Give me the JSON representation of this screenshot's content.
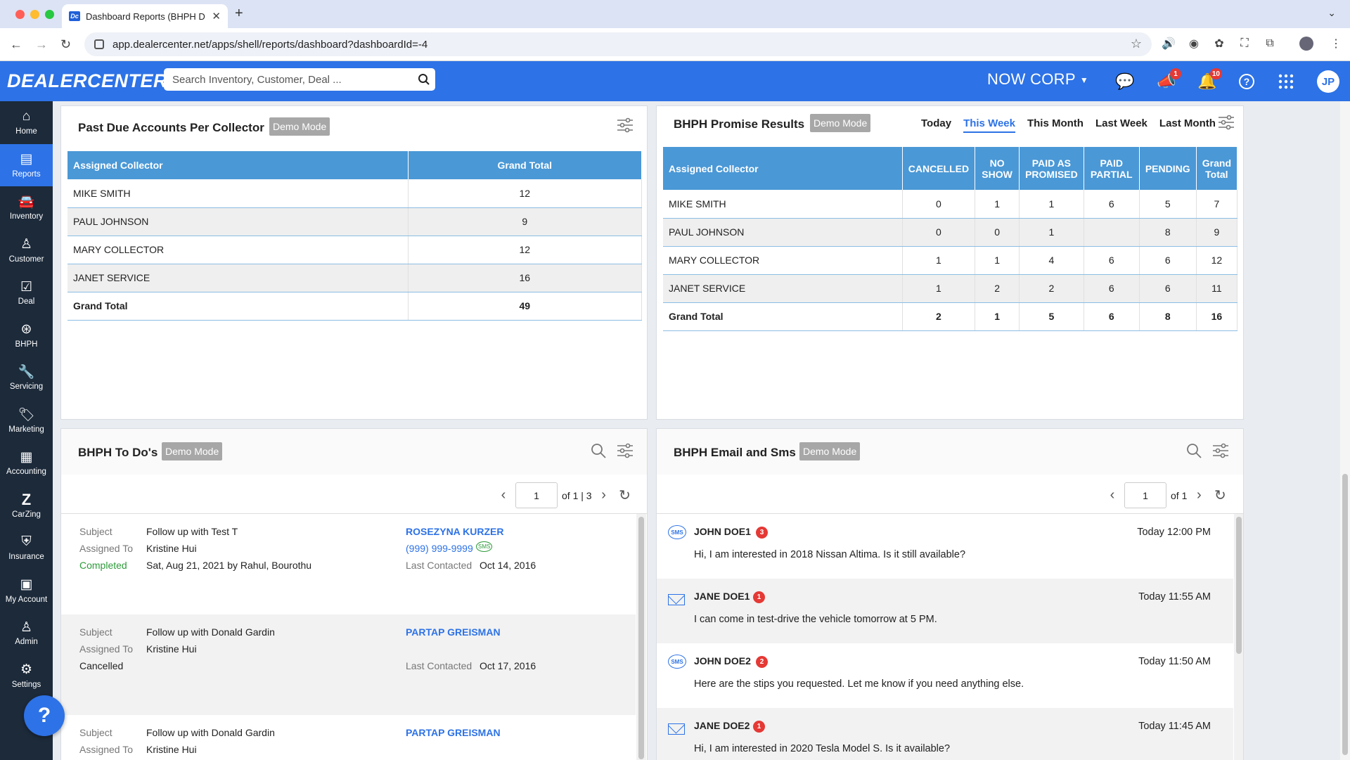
{
  "browser": {
    "tab_title": "Dashboard Reports (BHPH D",
    "favicon_text": "Dc",
    "url": "app.dealercenter.net/apps/shell/reports/dashboard?dashboardId=-4"
  },
  "header": {
    "logo": "DEALERCENTER",
    "search_placeholder": "Search Inventory, Customer, Deal ...",
    "company": "NOW CORP",
    "announcements_count": "1",
    "notifications_count": "10",
    "avatar_initials": "JP",
    "accent_color": "#2d72e6"
  },
  "sidebar": {
    "items": [
      {
        "label": "Home",
        "icon": "home-icon"
      },
      {
        "label": "Reports",
        "icon": "reports-icon"
      },
      {
        "label": "Inventory",
        "icon": "car-icon"
      },
      {
        "label": "Customer",
        "icon": "customer-icon"
      },
      {
        "label": "Deal",
        "icon": "deal-icon"
      },
      {
        "label": "BHPH",
        "icon": "bhph-icon"
      },
      {
        "label": "Servicing",
        "icon": "wrench-icon"
      },
      {
        "label": "Marketing",
        "icon": "tag-icon"
      },
      {
        "label": "Accounting",
        "icon": "calculator-icon"
      },
      {
        "label": "CarZing",
        "icon": "carzing-icon"
      },
      {
        "label": "Insurance",
        "icon": "shield-icon"
      },
      {
        "label": "My Account",
        "icon": "account-icon"
      },
      {
        "label": "Admin",
        "icon": "admin-icon"
      },
      {
        "label": "Settings",
        "icon": "gear-icon"
      }
    ],
    "help_label": "?"
  },
  "past_due": {
    "title": "Past Due Accounts Per Collector",
    "demo": "Demo Mode",
    "headers": [
      "Assigned Collector",
      "Grand Total"
    ],
    "rows": [
      [
        "MIKE SMITH",
        "12"
      ],
      [
        "PAUL JOHNSON",
        "9"
      ],
      [
        "MARY COLLECTOR",
        "12"
      ],
      [
        "JANET SERVICE",
        "16"
      ],
      [
        "Grand Total",
        "49"
      ]
    ]
  },
  "promise": {
    "title": "BHPH Promise Results",
    "demo": "Demo Mode",
    "periods": [
      "Today",
      "This Week",
      "This Month",
      "Last Week",
      "Last Month"
    ],
    "active_period": "This Week",
    "headers": [
      "Assigned Collector",
      "CANCELLED",
      "NO SHOW",
      "PAID AS PROMISED",
      "PAID PARTIAL",
      "PENDING",
      "Grand Total"
    ],
    "rows": [
      [
        "MIKE SMITH",
        "0",
        "1",
        "1",
        "6",
        "5",
        "7"
      ],
      [
        "PAUL JOHNSON",
        "0",
        "0",
        "1",
        "",
        "8",
        "9"
      ],
      [
        "MARY COLLECTOR",
        "1",
        "1",
        "4",
        "6",
        "6",
        "12"
      ],
      [
        "JANET SERVICE",
        "1",
        "2",
        "2",
        "6",
        "6",
        "11"
      ],
      [
        "Grand Total",
        "2",
        "1",
        "5",
        "6",
        "8",
        "16"
      ]
    ]
  },
  "todos": {
    "title": "BHPH To Do's",
    "demo": "Demo Mode",
    "page": "1",
    "page_of": "of 1 | 3",
    "labels": {
      "subject": "Subject",
      "assigned": "Assigned To",
      "last_contacted": "Last Contacted"
    },
    "items": [
      {
        "subject": "Follow up with Test T",
        "assigned": "Kristine Hui",
        "status": "Completed",
        "status_detail": "Sat, Aug 21, 2021 by Rahul, Bourothu",
        "customer": "ROSEZYNA KURZER",
        "phone": "(999) 999-9999",
        "last_contacted": "Oct 14, 2016"
      },
      {
        "subject": "Follow up with Donald Gardin",
        "assigned": "Kristine Hui",
        "status": "Cancelled",
        "status_detail": "",
        "customer": "PARTAP GREISMAN",
        "phone": "",
        "last_contacted": "Oct 17, 2016"
      },
      {
        "subject": "Follow up with Donald Gardin",
        "assigned": "Kristine Hui",
        "status": "",
        "status_detail": "",
        "customer": "PARTAP GREISMAN",
        "phone": "",
        "last_contacted": ""
      }
    ]
  },
  "messages": {
    "title": "BHPH Email and Sms",
    "demo": "Demo Mode",
    "page": "1",
    "page_of": "of 1",
    "items": [
      {
        "type": "sms",
        "name": "JOHN DOE1",
        "count": "3",
        "time": "Today 12:00 PM",
        "text": "Hi, I am interested in 2018 Nissan Altima. Is it still available?"
      },
      {
        "type": "email",
        "name": "JANE DOE1",
        "count": "1",
        "time": "Today 11:55 AM",
        "text": "I can come in test-drive the vehicle tomorrow at 5 PM."
      },
      {
        "type": "sms",
        "name": "JOHN DOE2",
        "count": "2",
        "time": "Today 11:50 AM",
        "text": "Here are the stips you requested. Let me know if you need anything else."
      },
      {
        "type": "email",
        "name": "JANE DOE2",
        "count": "1",
        "time": "Today 11:45 AM",
        "text": "Hi, I am interested in 2020 Tesla Model S. Is it available?"
      }
    ]
  }
}
